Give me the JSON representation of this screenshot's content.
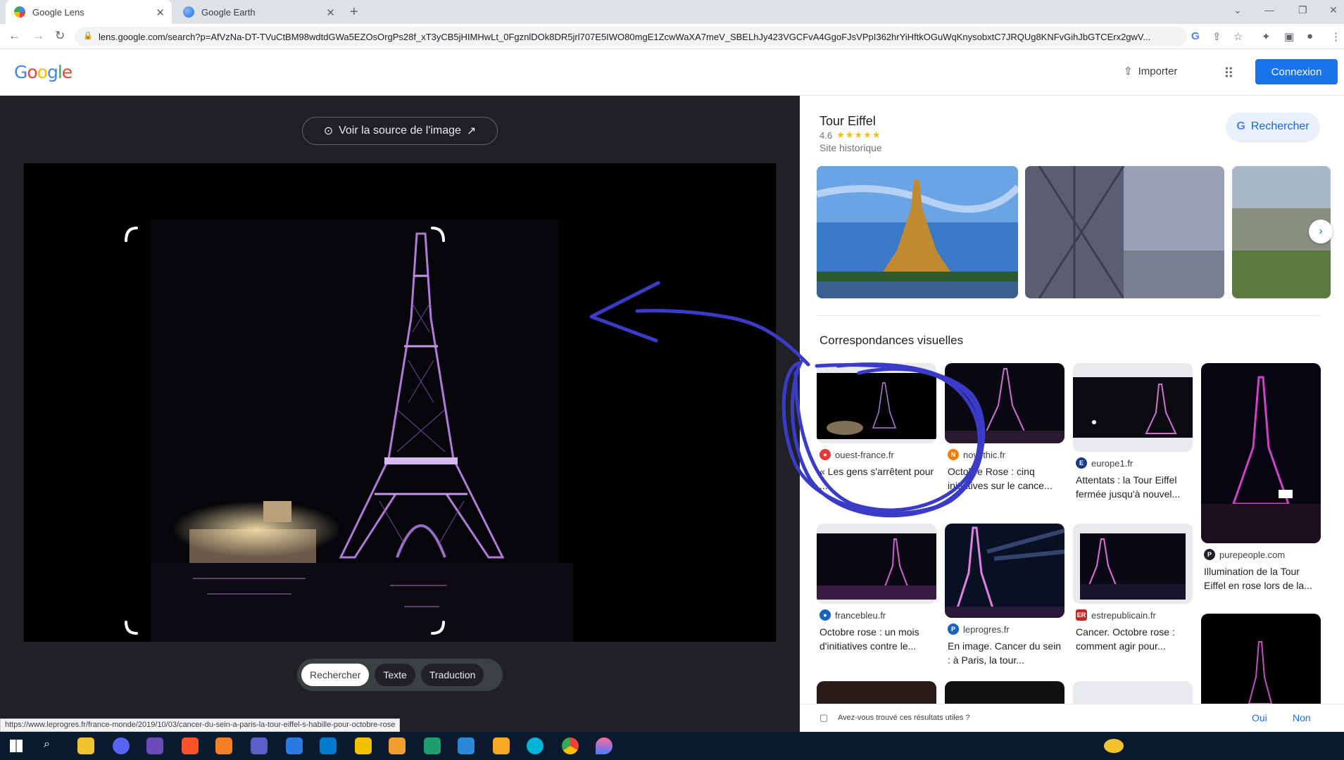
{
  "browser": {
    "tabs": [
      {
        "label": "Google Lens",
        "active": true
      },
      {
        "label": "Google Earth",
        "active": false
      }
    ],
    "url": "lens.google.com/search?p=AfVzNa-DT-TVuCtBM98wdtdGWa5EZOsOrgPs28f_xT3yCB5jHIMHwLt_0FgznlDOk8DR5jrl707E5IWO80mgE1ZcwWaXA7meV_SBELhJy423VGCFvA4GgoFJsVPpI362hrYiHftkOGuWqKnysobxtC7JRQUg8KNFvGihJbGTCErx2gwV..."
  },
  "header": {
    "logo": "Google",
    "import_label": "Importer",
    "signin_label": "Connexion"
  },
  "lens": {
    "source_button": "Voir la source de l'image",
    "modes": [
      "Rechercher",
      "Texte",
      "Traduction"
    ],
    "status_url": "https://www.leprogres.fr/france-monde/2019/10/03/cancer-du-sein-a-paris-la-tour-eiffel-s-habille-pour-octobre-rose"
  },
  "knowledge": {
    "title": "Tour Eiffel",
    "rating": "4.6",
    "stars": "★★★★★",
    "subtitle": "Site historique",
    "search_button": "Rechercher"
  },
  "visual_matches": {
    "title": "Correspondances visuelles",
    "items": [
      {
        "source": "ouest-france.fr",
        "title": "« Les gens s'arrêtent pour ..."
      },
      {
        "source": "novethic.fr",
        "title": "Octobre Rose : cinq initiatives sur le cance..."
      },
      {
        "source": "europe1.fr",
        "title": "Attentats : la Tour Eiffel fermée jusqu'à nouvel..."
      },
      {
        "source": "purepeople.com",
        "title": "Illumination de la Tour Eiffel en rose lors de la..."
      },
      {
        "source": "francebleu.fr",
        "title": "Octobre rose : un mois d'initiatives contre le..."
      },
      {
        "source": "leprogres.fr",
        "title": "En image. Cancer du sein : à Paris, la tour..."
      },
      {
        "source": "estrepublicain.fr",
        "title": "Cancer. Octobre rose : comment agir pour..."
      }
    ]
  },
  "feedback": {
    "question": "Avez-vous trouvé ces résultats utiles ?",
    "yes": "Oui",
    "no": "Non"
  },
  "colors": {
    "accent": "#1a73e8",
    "lens_bg": "#202124",
    "annotation": "#3a3cc8",
    "tower_purple": "#b07ad8"
  }
}
